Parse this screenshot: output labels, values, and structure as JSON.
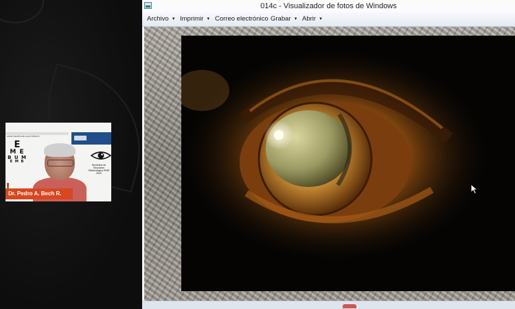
{
  "window": {
    "title": "014c - Visualizador de fotos de Windows"
  },
  "menu": [
    {
      "label": "Archivo",
      "has_dropdown": true
    },
    {
      "label": "Imprimir",
      "has_dropdown": true
    },
    {
      "label": "Correo electrónico",
      "has_dropdown": false
    },
    {
      "label": "Grabar",
      "has_dropdown": true
    },
    {
      "label": "Abrir",
      "has_dropdown": true
    }
  ],
  "webcam": {
    "presenter_name": "Dr. Pedro A. Bech R.",
    "slide_url": "www.facebook.com/obtech",
    "eye_chart": [
      "E",
      "M E",
      "B U M",
      "E M B"
    ],
    "logo_text": "Seminario de Educación Oftalmológica IPME 2020"
  },
  "icons": {
    "app": "photo-viewer-icon",
    "caret": "caret-down-icon",
    "cursor": "mouse-pointer-icon"
  },
  "colors": {
    "name_tag": "#d8471f",
    "menubar": "#e4eaf2"
  }
}
